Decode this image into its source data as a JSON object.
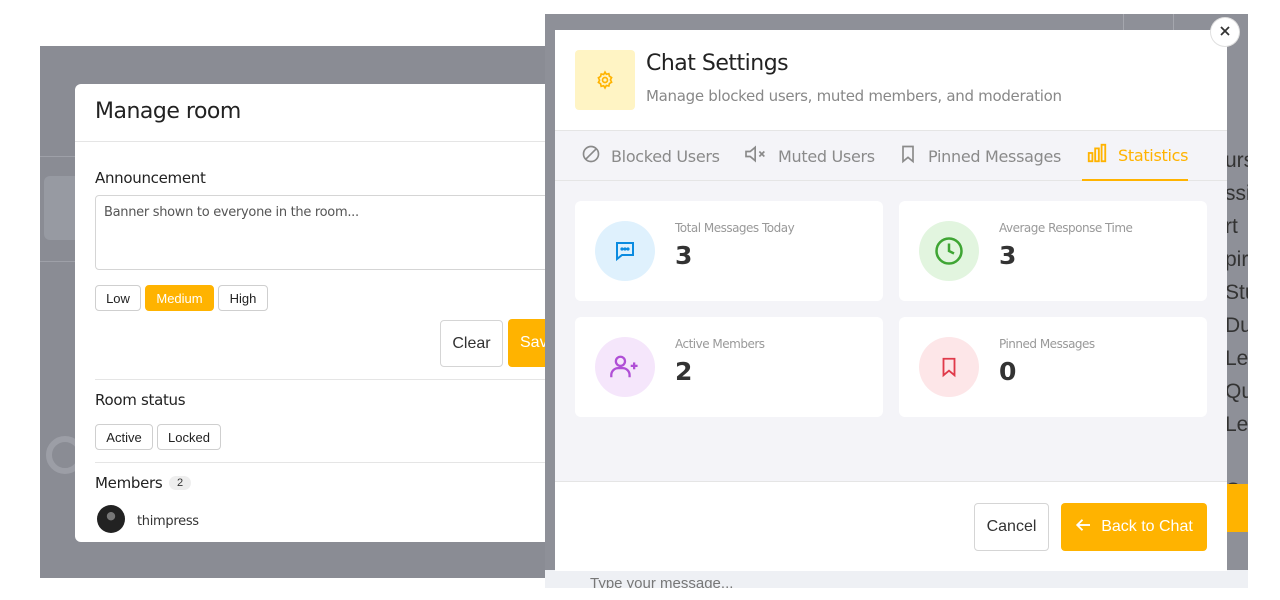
{
  "manage_room": {
    "title": "Manage room",
    "announcement_label": "Announcement",
    "announcement_placeholder": "Banner shown to everyone in the room...",
    "priority_options": [
      "Low",
      "Medium",
      "High"
    ],
    "priority_selected": "Medium",
    "clear_label": "Clear",
    "save_label": "Sav",
    "status_label": "Room status",
    "status_options": [
      "Active",
      "Locked"
    ],
    "members_label": "Members",
    "members_count": "2",
    "members": [
      {
        "name": "thimpress"
      }
    ]
  },
  "background_window": {
    "cutoff_lines": "urs\nssi\nrt\npiry\nStu\nDu\nLes\nQu\nLe\n\nCo\nSh",
    "message_placeholder": "Type your message..."
  },
  "chat_settings": {
    "title": "Chat Settings",
    "subtitle": "Manage blocked users, muted members, and moderation",
    "tabs": [
      {
        "label": "Blocked Users",
        "icon": "block-icon"
      },
      {
        "label": "Muted Users",
        "icon": "mute-icon"
      },
      {
        "label": "Pinned Messages",
        "icon": "bookmark-icon"
      },
      {
        "label": "Statistics",
        "icon": "bar-chart-icon"
      }
    ],
    "active_tab": "Statistics",
    "stats": [
      {
        "label": "Total Messages Today",
        "value": "3",
        "icon": "chat-bubble-icon",
        "color": "#0a8be0",
        "bg": "#dff1fd"
      },
      {
        "label": "Average Response Time",
        "value": "3",
        "icon": "clock-icon",
        "color": "#3fa534",
        "bg": "#e2f5df"
      },
      {
        "label": "Active Members",
        "value": "2",
        "icon": "user-add-icon",
        "color": "#b04fd6",
        "bg": "#f5e6fb"
      },
      {
        "label": "Pinned Messages",
        "value": "0",
        "icon": "bookmark-icon",
        "color": "#e03a4a",
        "bg": "#fde6e8"
      }
    ],
    "cancel_label": "Cancel",
    "back_label": "Back to Chat"
  },
  "colors": {
    "accent": "#ffb300",
    "overlay": "#8a8c94"
  }
}
